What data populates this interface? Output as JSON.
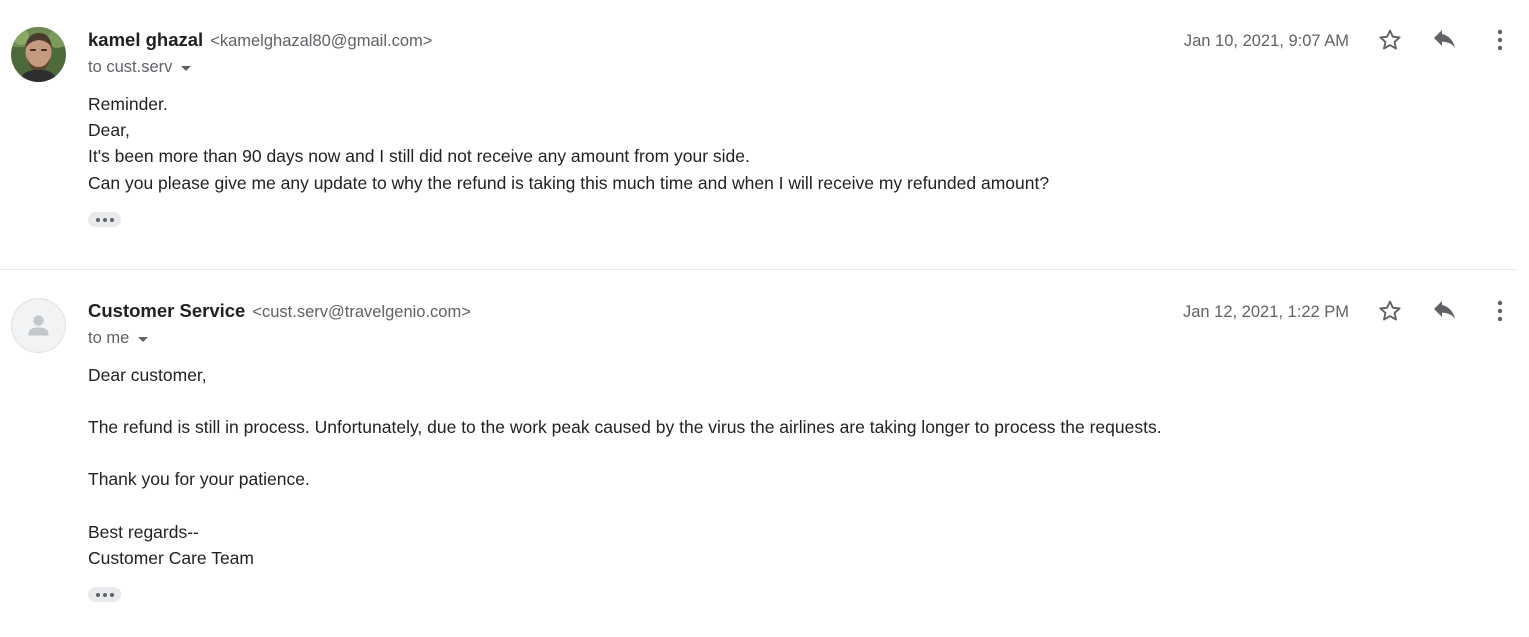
{
  "messages": [
    {
      "sender_name": "kamel ghazal",
      "sender_email": "<kamelghazal80@gmail.com>",
      "recipient": "to cust.serv",
      "date": "Jan 10, 2021, 9:07 AM",
      "avatar": "user-photo",
      "body": [
        "Reminder.",
        "Dear,",
        "It's been more than 90 days now and I still did not receive any amount from your side.",
        "Can you please give me any update to why the refund is taking this much time and when I will receive my refunded amount?"
      ]
    },
    {
      "sender_name": "Customer Service",
      "sender_email": "<cust.serv@travelgenio.com>",
      "recipient": "to me",
      "date": "Jan 12, 2021, 1:22 PM",
      "avatar": "default-person-icon",
      "body": [
        "Dear customer,",
        "The refund is still in process. Unfortunately, due to the work peak caused by the virus the airlines are taking longer to process the requests.",
        "Thank you for your patience.",
        "Best regards--",
        "Customer Care Team"
      ]
    }
  ],
  "icons": [
    "star-icon",
    "reply-icon",
    "more-vert-icon",
    "expand-ellipsis-icon",
    "caret-down-icon"
  ],
  "colors": {
    "text": "#222222",
    "secondary_text": "#5f6368",
    "divider": "#e6e6e6",
    "ellipsis_bg": "#e8eaed"
  }
}
